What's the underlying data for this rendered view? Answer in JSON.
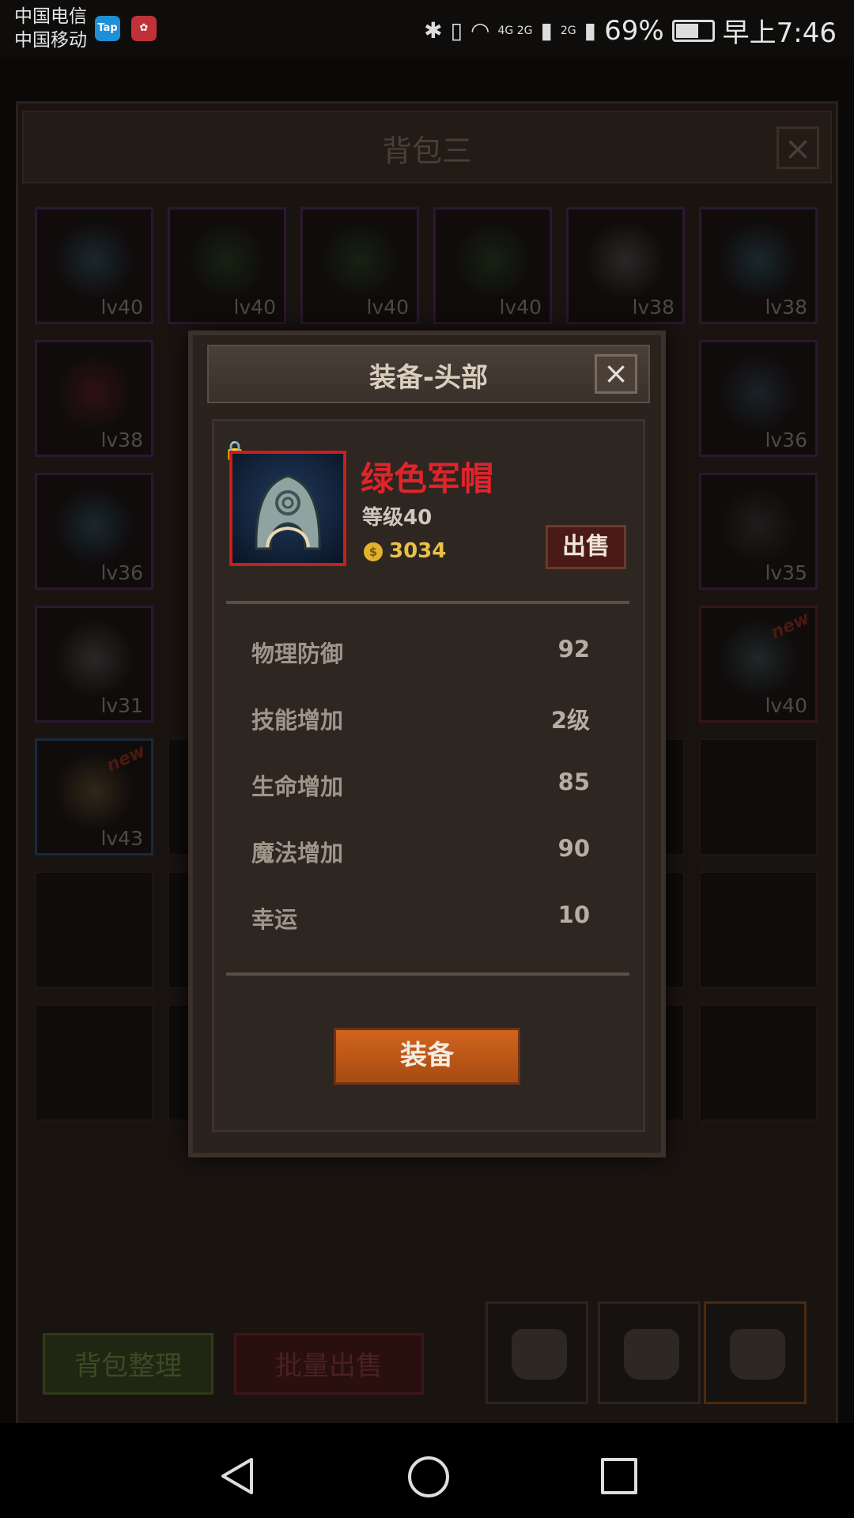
{
  "status_bar": {
    "carrier_1": "中国电信",
    "carrier_2": "中国移动",
    "app_badge_1": "Tap",
    "battery_percent": "69%",
    "battery_level": 0.69,
    "network_1": "4G 2G",
    "network_2": "2G",
    "time": "早上7:46"
  },
  "background": {
    "title": "背包三",
    "slots": [
      {
        "level": "lv40"
      },
      {
        "level": "lv40"
      },
      {
        "level": "lv40"
      },
      {
        "level": "lv40"
      },
      {
        "level": "lv38"
      },
      {
        "level": "lv38"
      },
      {
        "level": "lv38"
      },
      {
        "level": "lv36"
      },
      {
        "level": "lv36"
      },
      {
        "level": "lv35"
      },
      {
        "level": "lv31"
      },
      {
        "level": "lv40"
      },
      {
        "level": "lv43"
      }
    ],
    "new_tag": "new",
    "sort_button": "背包整理",
    "bulk_sell_button": "批量出售"
  },
  "modal": {
    "title": "装备-头部",
    "item_name": "绿色军帽",
    "item_level": "等级40",
    "price": "3034",
    "sell_button": "出售",
    "stats": [
      {
        "label": "物理防御",
        "value": "92"
      },
      {
        "label": "技能增加",
        "value": "2级"
      },
      {
        "label": "生命增加",
        "value": "85"
      },
      {
        "label": "魔法增加",
        "value": "90"
      },
      {
        "label": "幸运",
        "value": "10"
      }
    ],
    "equip_button": "装备"
  },
  "colors": {
    "item_name": "#e0242a",
    "equip_button": "#c85a18",
    "price": "#e7c14a"
  }
}
